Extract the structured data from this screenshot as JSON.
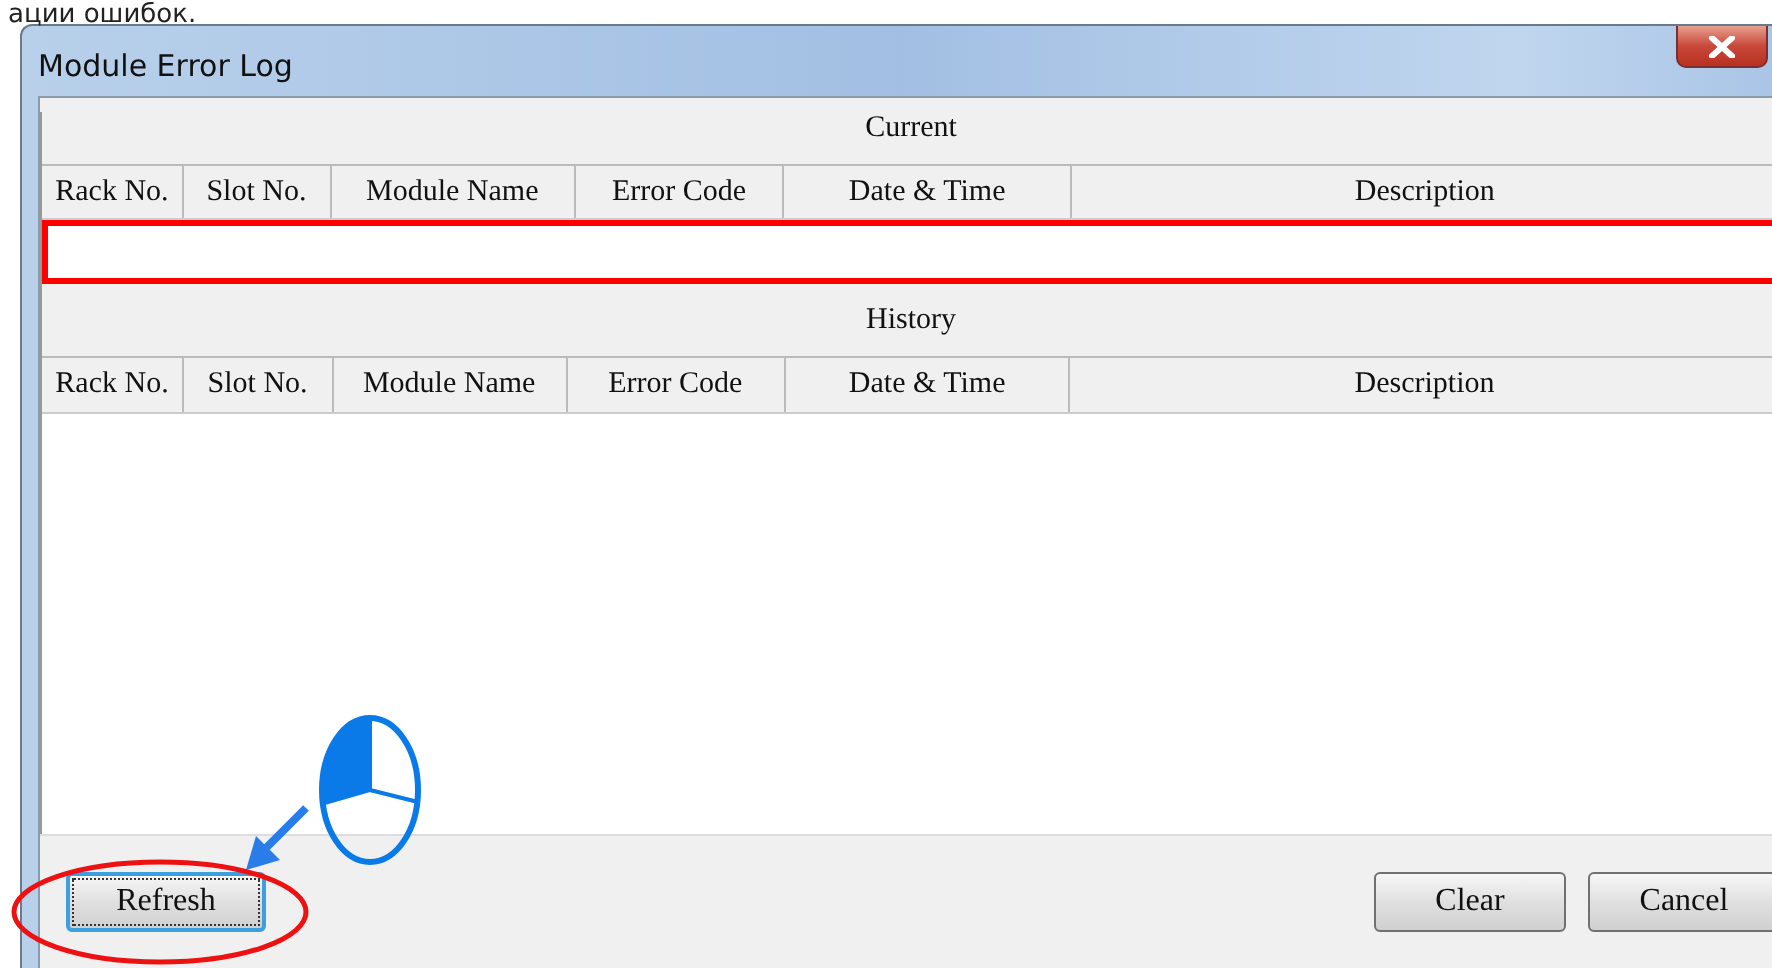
{
  "caption_text": "ации ошибок.",
  "window": {
    "title": "Module Error Log"
  },
  "current": {
    "title": "Current",
    "columns": [
      "Rack No.",
      "Slot No.",
      "Module Name",
      "Error Code",
      "Date & Time",
      "Description"
    ]
  },
  "history": {
    "title": "History",
    "columns": [
      "Rack No.",
      "Slot No.",
      "Module Name",
      "Error Code",
      "Date & Time",
      "Description"
    ]
  },
  "footer": {
    "left_buttons": [
      {
        "label": "Refresh",
        "focused": true
      }
    ],
    "right_buttons": [
      {
        "label": "Clear",
        "focused": false
      },
      {
        "label": "Cancel",
        "focused": false
      }
    ]
  }
}
